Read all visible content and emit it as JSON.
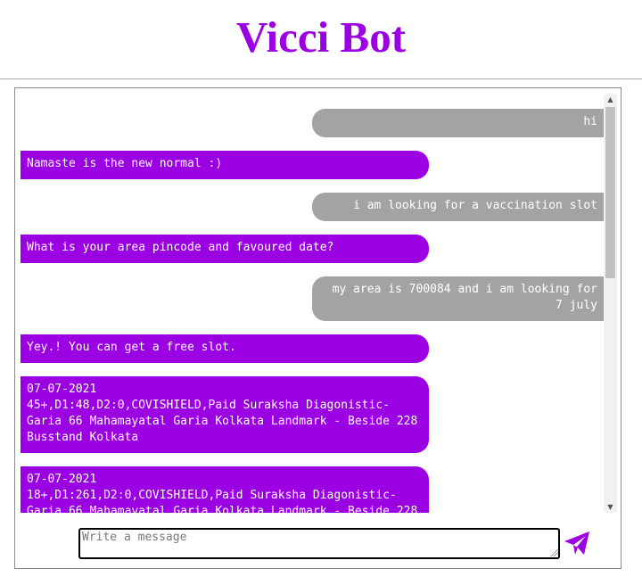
{
  "app": {
    "title": "Vicci Bot"
  },
  "theme": {
    "accent": "#9b00e3",
    "user_bubble": "#a3a3a3",
    "text_on_bubble": "#ffffff"
  },
  "chat": {
    "messages": [
      {
        "sender": "user",
        "text": "hi"
      },
      {
        "sender": "bot",
        "text": "Namaste is the new normal :)"
      },
      {
        "sender": "user",
        "text": "i am looking for a vaccination slot"
      },
      {
        "sender": "bot",
        "text": "What is your area pincode and favoured date?"
      },
      {
        "sender": "user",
        "text": "my area is 700084 and i am looking for 7 july"
      },
      {
        "sender": "bot",
        "text": "Yey.! You can get a free slot."
      },
      {
        "sender": "bot",
        "text": "07-07-2021\n45+,D1:48,D2:0,COVISHIELD,Paid Suraksha Diagonistic-Garia 66 Mahamayatal Garia Kolkata Landmark - Beside 228 Busstand Kolkata"
      },
      {
        "sender": "bot",
        "text": "07-07-2021\n18+,D1:261,D2:0,COVISHIELD,Paid Suraksha Diagonistic-Garia 66 Mahamayatal Garia Kolkata Landmark - Beside 228"
      }
    ]
  },
  "composer": {
    "placeholder": "Write a message",
    "value": ""
  },
  "icons": {
    "send": "send-icon",
    "scroll_up": "scroll-up-arrow-icon",
    "scroll_down": "scroll-down-arrow-icon"
  }
}
